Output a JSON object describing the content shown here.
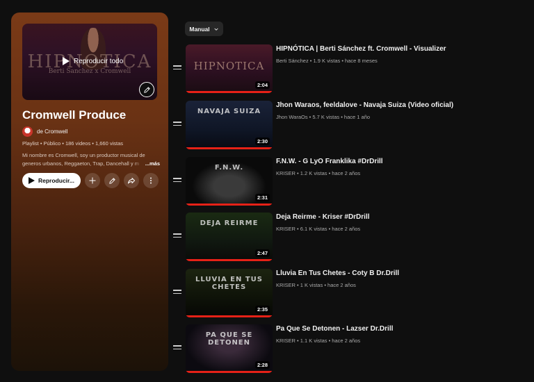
{
  "playlist": {
    "hero_art_title": "HIPNOTICA",
    "hero_art_subtitle": "Berti Sanchez x Cromwell",
    "play_all": "Reproducir todo",
    "title": "Cromwell Produce",
    "owner": "de Cromwell",
    "meta": "Playlist • Público • 186 videos • 1,660 vistas",
    "description": "Mi nombre es Cromwell, soy un productor musical de generos urbanos, Reggaeton, Trap, Dancehall y m",
    "more": "...más",
    "play_button": "Reproducir..."
  },
  "sort": {
    "label": "Manual"
  },
  "videos": [
    {
      "title": "HIPNÓTICA | Berti Sánchez ft. Cromwell - Visualizer",
      "meta": "Berti Sánchez • 1.9 K vistas • hace 8 meses",
      "duration": "2:04",
      "art_text": "HIPNOTICA"
    },
    {
      "title": "Jhon Waraos, feeldalove - Navaja Suiza (Video oficial)",
      "meta": "Jhon WaraOs • 5.7 K vistas • hace 1 año",
      "duration": "2:30",
      "art_text": "NAVAJA SUIZA"
    },
    {
      "title": "F.N.W. - G LyO Franklika #DrDrill",
      "meta": "KRISER • 1.2 K vistas • hace 2 años",
      "duration": "2:31",
      "art_text": "F.N.W."
    },
    {
      "title": "Deja Reirme - Kriser #DrDrill",
      "meta": "KRISER • 6.1 K vistas • hace 2 años",
      "duration": "2:47",
      "art_text": "DEJA REIRME"
    },
    {
      "title": "Lluvia En Tus Chetes - Coty B Dr.Drill",
      "meta": "KRISER • 1 K vistas • hace 2 años",
      "duration": "2:35",
      "art_text": "LLUVIA EN TUS CHETES"
    },
    {
      "title": "Pa Que Se Detonen - Lazser Dr.Drill",
      "meta": "KRISER • 1.1 K vistas • hace 2 años",
      "duration": "2:28",
      "art_text": "PA QUE SE DETONEN"
    }
  ],
  "colors": {
    "accent_red": "#e62117",
    "panel_brown": "#6a3214",
    "background": "#0f0f0f"
  }
}
